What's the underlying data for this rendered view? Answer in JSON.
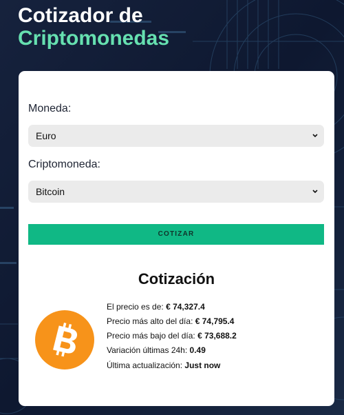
{
  "header": {
    "title_line1": "Cotizador de",
    "title_line2": "Criptomonedas"
  },
  "form": {
    "currency_label": "Moneda:",
    "currency_value": "Euro",
    "crypto_label": "Criptomoneda:",
    "crypto_value": "Bitcoin",
    "submit_label": "COTIZAR"
  },
  "result": {
    "title": "Cotización",
    "coin_icon": "bitcoin-icon",
    "price_label": "El precio es de:",
    "price_value": "€ 74,327.4",
    "high_label": "Precio más alto del día:",
    "high_value": "€ 74,795.4",
    "low_label": "Precio más bajo del día:",
    "low_value": "€ 73,688.2",
    "change_label": "Variación últimas 24h:",
    "change_value": "0.49",
    "updated_label": "Última actualización:",
    "updated_value": "Just now"
  },
  "colors": {
    "accent_green": "#66e0b0",
    "button_green": "#10b885",
    "bitcoin_orange": "#f7931a",
    "background_navy": "#0f1a33"
  }
}
